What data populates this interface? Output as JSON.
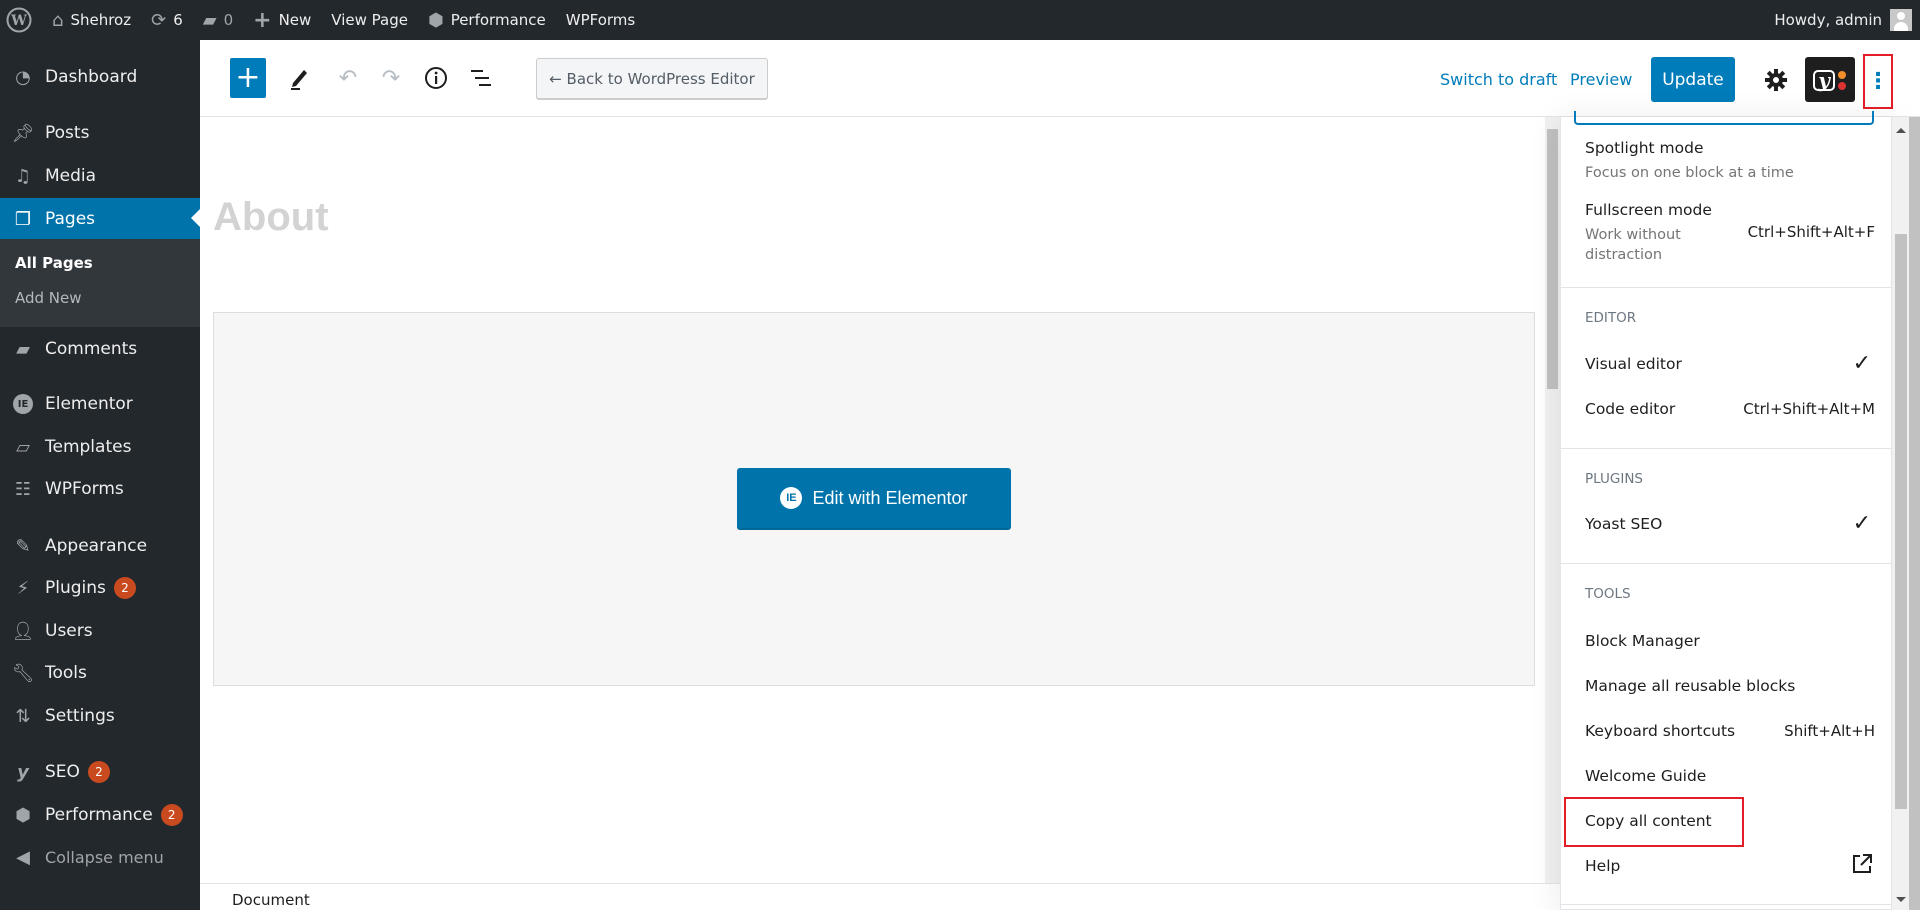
{
  "adminbar": {
    "site_name": "Shehroz",
    "updates_count": "6",
    "comments_count": "0",
    "new_label": "New",
    "view_page_label": "View Page",
    "performance_label": "Performance",
    "wpforms_label": "WPForms",
    "greeting": "Howdy, admin"
  },
  "sidebar": {
    "items": [
      {
        "label": "Dashboard",
        "icon": "dashboard-icon"
      },
      {
        "label": "Posts",
        "icon": "pin-icon"
      },
      {
        "label": "Media",
        "icon": "media-icon"
      },
      {
        "label": "Pages",
        "icon": "pages-icon",
        "active": true
      },
      {
        "label": "Comments",
        "icon": "comment-icon"
      },
      {
        "label": "Elementor",
        "icon": "elementor-icon"
      },
      {
        "label": "Templates",
        "icon": "folder-icon"
      },
      {
        "label": "WPForms",
        "icon": "form-icon"
      },
      {
        "label": "Appearance",
        "icon": "brush-icon"
      },
      {
        "label": "Plugins",
        "icon": "plug-icon",
        "badge": "2"
      },
      {
        "label": "Users",
        "icon": "user-icon"
      },
      {
        "label": "Tools",
        "icon": "wrench-icon"
      },
      {
        "label": "Settings",
        "icon": "sliders-icon"
      },
      {
        "label": "SEO",
        "icon": "yoast-icon",
        "badge": "2"
      },
      {
        "label": "Performance",
        "icon": "performance-icon",
        "badge": "2"
      }
    ],
    "submenu": [
      "All Pages",
      "Add New"
    ],
    "collapse_label": "Collapse menu"
  },
  "toolbar": {
    "back_label": "← Back to WordPress Editor",
    "switch_draft_label": "Switch to draft",
    "preview_label": "Preview",
    "update_label": "Update"
  },
  "content": {
    "page_title": "About",
    "edit_elementor_label": "Edit with Elementor"
  },
  "footer": {
    "breadcrumb": "Document"
  },
  "more_menu": {
    "view_items": [
      {
        "label": "Spotlight mode",
        "desc": "Focus on one block at a time"
      },
      {
        "label": "Fullscreen mode",
        "desc": "Work without distraction",
        "shortcut": "Ctrl+Shift+Alt+F"
      }
    ],
    "editor_title": "Editor",
    "editor_items": [
      {
        "label": "Visual editor",
        "checked": "✓"
      },
      {
        "label": "Code editor",
        "shortcut": "Ctrl+Shift+Alt+M"
      }
    ],
    "plugins_title": "Plugins",
    "plugin_items": [
      {
        "label": "Yoast SEO",
        "checked": "✓"
      }
    ],
    "tools_title": "Tools",
    "tool_items": [
      {
        "label": "Block Manager"
      },
      {
        "label": "Manage all reusable blocks"
      },
      {
        "label": "Keyboard shortcuts",
        "shortcut": "Shift+Alt+H"
      },
      {
        "label": "Welcome Guide"
      },
      {
        "label": "Copy all content"
      },
      {
        "label": "Help"
      }
    ]
  },
  "colors": {
    "accent": "#007cba",
    "admin_bar": "#23282d",
    "highlight": "#e31e26",
    "badge": "#ca4a1f"
  }
}
